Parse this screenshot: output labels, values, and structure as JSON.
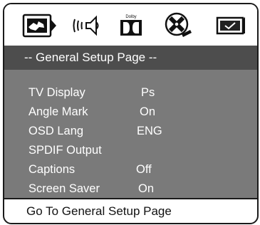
{
  "icons": [
    {
      "name": "tv-display-icon"
    },
    {
      "name": "audio-speaker-icon"
    },
    {
      "name": "dolby-digital-icon",
      "text": "Dolby"
    },
    {
      "name": "video-reel-icon"
    },
    {
      "name": "preferences-check-icon"
    }
  ],
  "header": {
    "title": "-- General Setup Page --"
  },
  "settings": [
    {
      "label": "TV Display",
      "value": "Ps"
    },
    {
      "label": "Angle Mark",
      "value": "On"
    },
    {
      "label": "OSD Lang",
      "value": "ENG"
    },
    {
      "label": "SPDIF Output",
      "value": ""
    },
    {
      "label": "Captions",
      "value": "Off"
    },
    {
      "label": "Screen Saver",
      "value": "On"
    }
  ],
  "footer": {
    "hint": "Go To General Setup Page"
  },
  "colors": {
    "title_bar": "#4d4d4d",
    "panel": "#7a7a7a",
    "text": "#ffffff",
    "border": "#1a1a1a"
  }
}
